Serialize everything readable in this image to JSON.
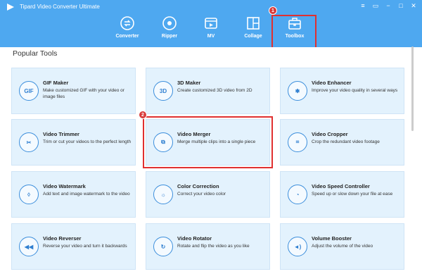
{
  "app": {
    "title": "Tipard Video Converter Ultimate"
  },
  "window_controls": [
    {
      "name": "menu-button",
      "glyph": "≡"
    },
    {
      "name": "chat-button",
      "glyph": "▭"
    },
    {
      "name": "minimize-button",
      "glyph": "−"
    },
    {
      "name": "maximize-button",
      "glyph": "□"
    },
    {
      "name": "close-button",
      "glyph": "✕"
    }
  ],
  "nav": {
    "tabs": [
      {
        "label": "Converter",
        "icon": "converter-icon"
      },
      {
        "label": "Ripper",
        "icon": "ripper-icon"
      },
      {
        "label": "MV",
        "icon": "mv-icon"
      },
      {
        "label": "Collage",
        "icon": "collage-icon"
      },
      {
        "label": "Toolbox",
        "icon": "toolbox-icon",
        "active": true
      }
    ]
  },
  "section": {
    "title": "Popular Tools"
  },
  "tools": [
    {
      "name": "GIF Maker",
      "desc": "Make customized GIF with your video or image files",
      "icon": "gif-icon",
      "glyph": "GIF"
    },
    {
      "name": "3D Maker",
      "desc": "Create customized 3D video from 2D",
      "icon": "3d-icon",
      "glyph": "3D"
    },
    {
      "name": "Video Enhancer",
      "desc": "Improve your video quality in several ways",
      "icon": "palette-icon",
      "glyph": "✱"
    },
    {
      "name": "Video Trimmer",
      "desc": "Trim or cut your videos to the perfect length",
      "icon": "scissors-icon",
      "glyph": "✂"
    },
    {
      "name": "Video Merger",
      "desc": "Merge multiple clips into a single piece",
      "icon": "merge-icon",
      "glyph": "⧉"
    },
    {
      "name": "Video Cropper",
      "desc": "Crop the redundant video footage",
      "icon": "crop-icon",
      "glyph": "⌗"
    },
    {
      "name": "Video Watermark",
      "desc": "Add text and image watermark to the video",
      "icon": "droplet-icon",
      "glyph": "◊"
    },
    {
      "name": "Color Correction",
      "desc": "Correct your video color",
      "icon": "sun-icon",
      "glyph": "☼"
    },
    {
      "name": "Video Speed Controller",
      "desc": "Speed up or slow down your file at ease",
      "icon": "speedometer-icon",
      "glyph": "◔"
    },
    {
      "name": "Video Reverser",
      "desc": "Reverse your video and turn it backwards",
      "icon": "rewind-icon",
      "glyph": "◀◀"
    },
    {
      "name": "Video Rotator",
      "desc": "Rotate and flip the video as you like",
      "icon": "rotate-icon",
      "glyph": "↻"
    },
    {
      "name": "Volume Booster",
      "desc": "Adjust the volume of the video",
      "icon": "speaker-icon",
      "glyph": "◄)"
    }
  ],
  "annotations": [
    {
      "label": "1"
    },
    {
      "label": "2"
    }
  ],
  "colors": {
    "header": "#4ea8f0",
    "tile_bg": "#e3f2fd",
    "accent": "#3d8fdc",
    "highlight": "#e03030"
  }
}
